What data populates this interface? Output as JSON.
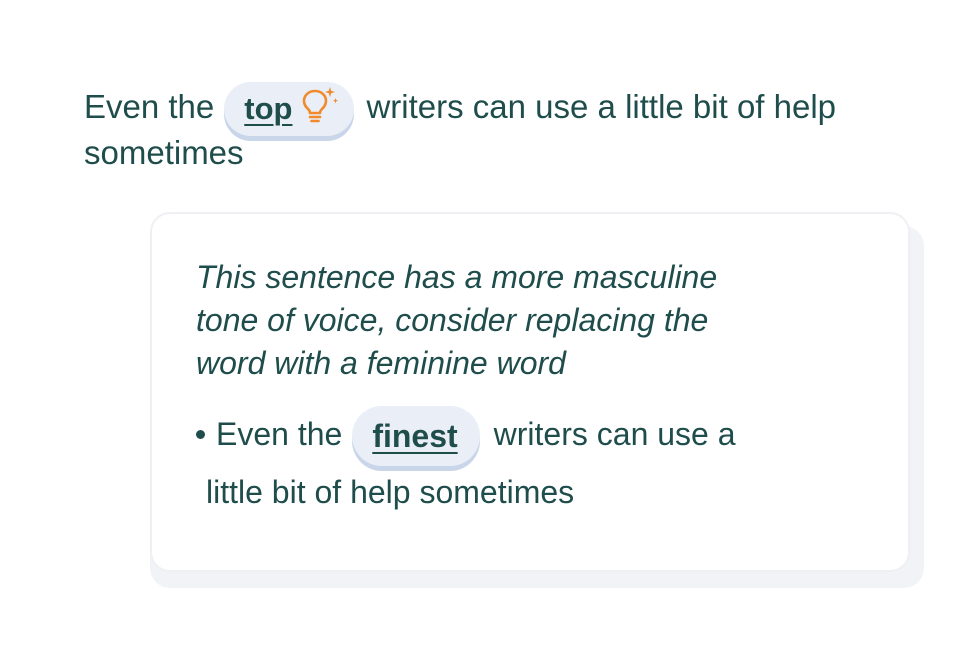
{
  "sentence": {
    "prefix": "Even the",
    "highlighted_word": "top",
    "suffix": "writers can use a little bit of help",
    "continuation": "sometimes",
    "icon": "lightbulb-sparkle-icon",
    "icon_color": "#f08a2c"
  },
  "suggestion_card": {
    "message_line1": "This sentence has a more masculine",
    "message_line2": "tone of voice, consider replacing the",
    "message_line3": "word with a feminine word",
    "option": {
      "prefix": "Even the",
      "replacement_word": "finest",
      "suffix": "writers can use a",
      "continuation": "little bit of help sometimes"
    }
  },
  "colors": {
    "text": "#1f4d4c",
    "chip_bg": "#eaeef6",
    "chip_shadow": "#c9d6ea",
    "card_shadow": "#f1f3f6"
  }
}
